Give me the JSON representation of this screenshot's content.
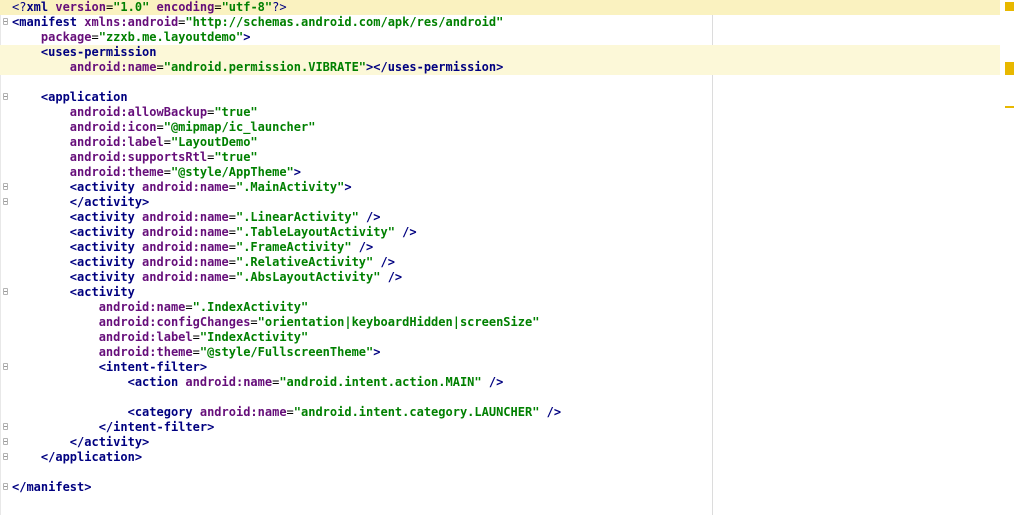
{
  "editor": {
    "colors": {
      "tag": "#000080",
      "attribute": "#660e7a",
      "value": "#008000",
      "line_highlight": "#fcf8d8",
      "marker": "#e8b800"
    },
    "lines": [
      {
        "indent": "",
        "tokens": [
          {
            "t": "pi",
            "v": "<?"
          },
          {
            "t": "tag",
            "v": "xml "
          },
          {
            "t": "attr",
            "v": "version"
          },
          {
            "t": "plain",
            "v": "="
          },
          {
            "t": "val",
            "v": "\"1.0\""
          },
          {
            "t": "plain",
            "v": " "
          },
          {
            "t": "attr",
            "v": "encoding"
          },
          {
            "t": "plain",
            "v": "="
          },
          {
            "t": "val",
            "v": "\"utf-8\""
          },
          {
            "t": "pi",
            "v": "?>"
          }
        ],
        "highlight": "caret"
      },
      {
        "indent": "",
        "fold": "open",
        "tokens": [
          {
            "t": "tag",
            "v": "<manifest "
          },
          {
            "t": "attr",
            "v": "xmlns:android"
          },
          {
            "t": "plain",
            "v": "="
          },
          {
            "t": "val",
            "v": "\"http://schemas.android.com/apk/res/android\""
          }
        ]
      },
      {
        "indent": "    ",
        "tokens": [
          {
            "t": "attr",
            "v": "package"
          },
          {
            "t": "plain",
            "v": "="
          },
          {
            "t": "val",
            "v": "\"zzxb.me.layoutdemo\""
          },
          {
            "t": "tag",
            "v": ">"
          }
        ]
      },
      {
        "indent": "    ",
        "tokens": [
          {
            "t": "tag",
            "v": "<uses-permission"
          }
        ],
        "highlight": "highlight"
      },
      {
        "indent": "        ",
        "tokens": [
          {
            "t": "attr",
            "v": "android:name"
          },
          {
            "t": "plain",
            "v": "="
          },
          {
            "t": "val",
            "v": "\"android.permission.VIBRATE\""
          },
          {
            "t": "tag",
            "v": "></uses-permission>"
          }
        ],
        "highlight": "highlight"
      },
      {
        "indent": "",
        "tokens": []
      },
      {
        "indent": "    ",
        "fold": "open",
        "tokens": [
          {
            "t": "tag",
            "v": "<application"
          }
        ]
      },
      {
        "indent": "        ",
        "tokens": [
          {
            "t": "attr",
            "v": "android:allowBackup"
          },
          {
            "t": "plain",
            "v": "="
          },
          {
            "t": "val",
            "v": "\"true\""
          }
        ]
      },
      {
        "indent": "        ",
        "tokens": [
          {
            "t": "attr",
            "v": "android:icon"
          },
          {
            "t": "plain",
            "v": "="
          },
          {
            "t": "val",
            "v": "\"@mipmap/ic_launcher\""
          }
        ]
      },
      {
        "indent": "        ",
        "tokens": [
          {
            "t": "attr",
            "v": "android:label"
          },
          {
            "t": "plain",
            "v": "="
          },
          {
            "t": "val",
            "v": "\"LayoutDemo\""
          }
        ]
      },
      {
        "indent": "        ",
        "tokens": [
          {
            "t": "attr",
            "v": "android:supportsRtl"
          },
          {
            "t": "plain",
            "v": "="
          },
          {
            "t": "val",
            "v": "\"true\""
          }
        ]
      },
      {
        "indent": "        ",
        "tokens": [
          {
            "t": "attr",
            "v": "android:theme"
          },
          {
            "t": "plain",
            "v": "="
          },
          {
            "t": "val",
            "v": "\"@style/AppTheme\""
          },
          {
            "t": "tag",
            "v": ">"
          }
        ]
      },
      {
        "indent": "        ",
        "fold": "open",
        "tokens": [
          {
            "t": "tag",
            "v": "<activity "
          },
          {
            "t": "attr",
            "v": "android:name"
          },
          {
            "t": "plain",
            "v": "="
          },
          {
            "t": "val",
            "v": "\".MainActivity\""
          },
          {
            "t": "tag",
            "v": ">"
          }
        ]
      },
      {
        "indent": "        ",
        "fold": "open",
        "tokens": [
          {
            "t": "tag",
            "v": "</activity>"
          }
        ]
      },
      {
        "indent": "        ",
        "tokens": [
          {
            "t": "tag",
            "v": "<activity "
          },
          {
            "t": "attr",
            "v": "android:name"
          },
          {
            "t": "plain",
            "v": "="
          },
          {
            "t": "val",
            "v": "\".LinearActivity\""
          },
          {
            "t": "tag",
            "v": " />"
          }
        ]
      },
      {
        "indent": "        ",
        "tokens": [
          {
            "t": "tag",
            "v": "<activity "
          },
          {
            "t": "attr",
            "v": "android:name"
          },
          {
            "t": "plain",
            "v": "="
          },
          {
            "t": "val",
            "v": "\".TableLayoutActivity\""
          },
          {
            "t": "tag",
            "v": " />"
          }
        ]
      },
      {
        "indent": "        ",
        "tokens": [
          {
            "t": "tag",
            "v": "<activity "
          },
          {
            "t": "attr",
            "v": "android:name"
          },
          {
            "t": "plain",
            "v": "="
          },
          {
            "t": "val",
            "v": "\".FrameActivity\""
          },
          {
            "t": "tag",
            "v": " />"
          }
        ]
      },
      {
        "indent": "        ",
        "tokens": [
          {
            "t": "tag",
            "v": "<activity "
          },
          {
            "t": "attr",
            "v": "android:name"
          },
          {
            "t": "plain",
            "v": "="
          },
          {
            "t": "val",
            "v": "\".RelativeActivity\""
          },
          {
            "t": "tag",
            "v": " />"
          }
        ]
      },
      {
        "indent": "        ",
        "tokens": [
          {
            "t": "tag",
            "v": "<activity "
          },
          {
            "t": "attr",
            "v": "android:name"
          },
          {
            "t": "plain",
            "v": "="
          },
          {
            "t": "val",
            "v": "\".AbsLayoutActivity\""
          },
          {
            "t": "tag",
            "v": " />"
          }
        ]
      },
      {
        "indent": "        ",
        "fold": "open",
        "tokens": [
          {
            "t": "tag",
            "v": "<activity"
          }
        ]
      },
      {
        "indent": "            ",
        "tokens": [
          {
            "t": "attr",
            "v": "android:name"
          },
          {
            "t": "plain",
            "v": "="
          },
          {
            "t": "val",
            "v": "\".IndexActivity\""
          }
        ]
      },
      {
        "indent": "            ",
        "tokens": [
          {
            "t": "attr",
            "v": "android:configChanges"
          },
          {
            "t": "plain",
            "v": "="
          },
          {
            "t": "val",
            "v": "\"orientation|keyboardHidden|screenSize\""
          }
        ]
      },
      {
        "indent": "            ",
        "tokens": [
          {
            "t": "attr",
            "v": "android:label"
          },
          {
            "t": "plain",
            "v": "="
          },
          {
            "t": "val",
            "v": "\"IndexActivity\""
          }
        ]
      },
      {
        "indent": "            ",
        "tokens": [
          {
            "t": "attr",
            "v": "android:theme"
          },
          {
            "t": "plain",
            "v": "="
          },
          {
            "t": "val",
            "v": "\"@style/FullscreenTheme\""
          },
          {
            "t": "tag",
            "v": ">"
          }
        ]
      },
      {
        "indent": "            ",
        "fold": "open",
        "tokens": [
          {
            "t": "tag",
            "v": "<intent-filter>"
          }
        ]
      },
      {
        "indent": "                ",
        "tokens": [
          {
            "t": "tag",
            "v": "<action "
          },
          {
            "t": "attr",
            "v": "android:name"
          },
          {
            "t": "plain",
            "v": "="
          },
          {
            "t": "val",
            "v": "\"android.intent.action.MAIN\""
          },
          {
            "t": "tag",
            "v": " />"
          }
        ]
      },
      {
        "indent": "",
        "tokens": []
      },
      {
        "indent": "                ",
        "tokens": [
          {
            "t": "tag",
            "v": "<category "
          },
          {
            "t": "attr",
            "v": "android:name"
          },
          {
            "t": "plain",
            "v": "="
          },
          {
            "t": "val",
            "v": "\"android.intent.category.LAUNCHER\""
          },
          {
            "t": "tag",
            "v": " />"
          }
        ]
      },
      {
        "indent": "            ",
        "fold": "open",
        "tokens": [
          {
            "t": "tag",
            "v": "</intent-filter>"
          }
        ]
      },
      {
        "indent": "        ",
        "fold": "open",
        "tokens": [
          {
            "t": "tag",
            "v": "</activity>"
          }
        ]
      },
      {
        "indent": "    ",
        "fold": "open",
        "tokens": [
          {
            "t": "tag",
            "v": "</application>"
          }
        ]
      },
      {
        "indent": "",
        "tokens": []
      },
      {
        "indent": "",
        "fold": "open",
        "tokens": [
          {
            "t": "tag",
            "v": "</manifest>"
          }
        ]
      }
    ]
  }
}
